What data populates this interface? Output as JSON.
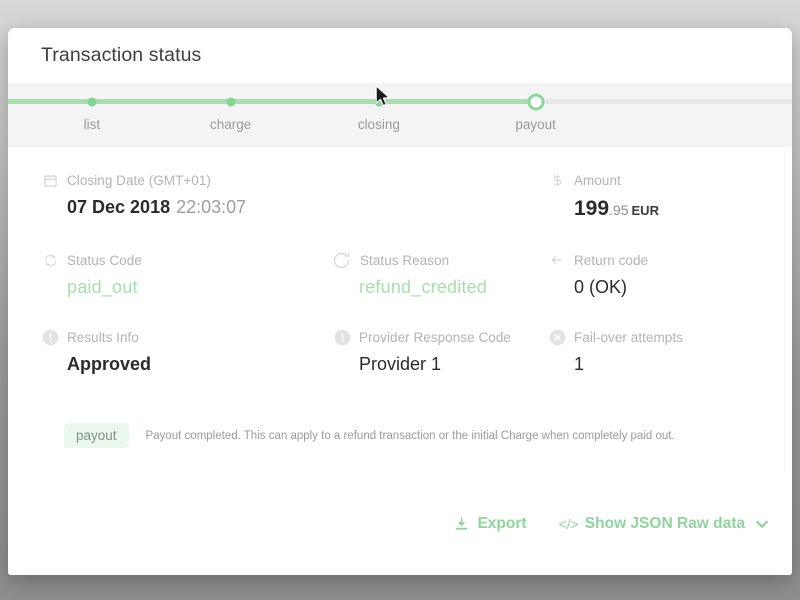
{
  "modal": {
    "title": "Transaction status"
  },
  "progress": {
    "steps": [
      {
        "label": "list",
        "state": "done",
        "position": 10.7
      },
      {
        "label": "charge",
        "state": "done",
        "position": 28.4
      },
      {
        "label": "closing",
        "state": "done",
        "position": 47.3
      },
      {
        "label": "payout",
        "state": "current",
        "position": 67.3
      }
    ],
    "fill_percent": 67.3,
    "fill_color": "#a6e0ae",
    "track_color": "#e8e8e8"
  },
  "details": {
    "rows": [
      [
        {
          "icon": "calendar-icon",
          "label": "Closing Date (GMT+01)",
          "value": "07 Dec 2018",
          "value_muted": "22:03:07",
          "style": "bold"
        },
        {
          "icon": "dollar-icon",
          "label": "Amount",
          "amount_main": "199",
          "amount_cents": ".95",
          "amount_currency": "EUR",
          "style": "amount"
        }
      ],
      [
        {
          "icon": "sync-icon",
          "label": "Status Code",
          "value": "paid_out",
          "style": "green"
        },
        {
          "icon": "refresh-icon",
          "label": "Status Reason",
          "value": "refund_credited",
          "style": "green"
        },
        {
          "icon": "arrow-left-icon",
          "label": "Return code",
          "value": "0 (OK)",
          "style": "plain"
        }
      ],
      [
        {
          "icon": "exclamation-circle-icon",
          "label": "Results Info",
          "value": "Approved",
          "style": "bold"
        },
        {
          "icon": "exclamation-circle-icon",
          "label": "Provider Response Code",
          "value": "Provider 1",
          "style": "plain"
        },
        {
          "icon": "x-circle-icon",
          "label": "Fail-over attempts",
          "value": "1",
          "style": "plain"
        }
      ]
    ]
  },
  "status_note": {
    "badge": "payout",
    "description": "Payout completed. This can apply to a refund transaction or the initial Charge when completely paid out."
  },
  "footer": {
    "export_label": "Export",
    "json_label": "Show JSON Raw data",
    "code_glyph": "</>",
    "accent_color": "#8ed49c"
  }
}
